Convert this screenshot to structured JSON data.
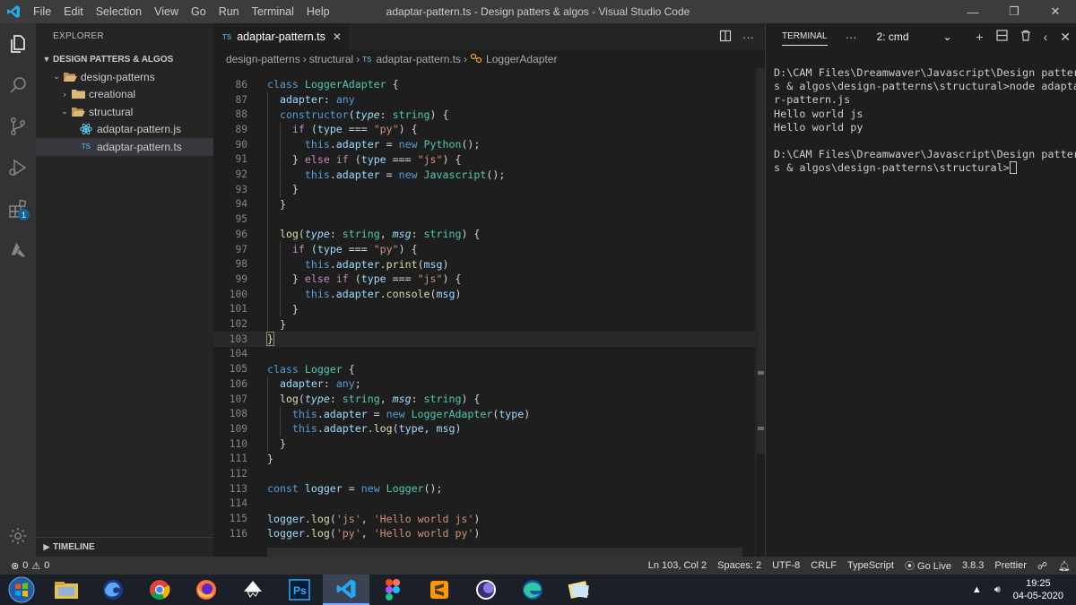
{
  "titlebar": {
    "menu": [
      "File",
      "Edit",
      "Selection",
      "View",
      "Go",
      "Run",
      "Terminal",
      "Help"
    ],
    "title": "adaptar-pattern.ts - Design patters & algos - Visual Studio Code"
  },
  "activitybar": {
    "extensions_badge": "1"
  },
  "sidebar": {
    "header": "EXPLORER",
    "workspace": "DESIGN PATTERS & ALGOS",
    "tree": [
      {
        "label": "design-patterns",
        "indent": 1,
        "expanded": true,
        "type": "folder"
      },
      {
        "label": "creational",
        "indent": 2,
        "expanded": false,
        "type": "folder"
      },
      {
        "label": "structural",
        "indent": 2,
        "expanded": true,
        "type": "folder"
      },
      {
        "label": "adaptar-pattern.js",
        "indent": 3,
        "type": "js"
      },
      {
        "label": "adaptar-pattern.ts",
        "indent": 3,
        "type": "ts",
        "selected": true
      }
    ],
    "timeline": "TIMELINE"
  },
  "editor": {
    "tab": {
      "icon": "TS",
      "label": "adaptar-pattern.ts"
    },
    "breadcrumb": [
      "design-patterns",
      "structural",
      "adaptar-pattern.ts",
      "LoggerAdapter"
    ],
    "current_line": 103,
    "lines": [
      {
        "n": 86,
        "t": [
          [
            "k2",
            "class "
          ],
          [
            "cl",
            "LoggerAdapter"
          ],
          [
            "dim",
            " "
          ],
          [
            "fn",
            "{"
          ]
        ]
      },
      {
        "n": 87,
        "t": [
          [
            "dim",
            "  "
          ],
          [
            "pr",
            "adapter"
          ],
          [
            "dim",
            ": "
          ],
          [
            "k2",
            "any"
          ]
        ]
      },
      {
        "n": 88,
        "t": [
          [
            "dim",
            "  "
          ],
          [
            "k2",
            "constructor"
          ],
          [
            "dim",
            "("
          ],
          [
            "prm",
            "type"
          ],
          [
            "dim",
            ": "
          ],
          [
            "ty",
            "string"
          ],
          [
            "dim",
            ") {"
          ]
        ]
      },
      {
        "n": 89,
        "t": [
          [
            "dim",
            "    "
          ],
          [
            "k",
            "if"
          ],
          [
            "dim",
            " ("
          ],
          [
            "pr",
            "type"
          ],
          [
            "dim",
            " === "
          ],
          [
            "st",
            "\"py\""
          ],
          [
            "dim",
            ") {"
          ]
        ]
      },
      {
        "n": 90,
        "t": [
          [
            "dim",
            "      "
          ],
          [
            "k2",
            "this"
          ],
          [
            "dim",
            "."
          ],
          [
            "pr",
            "adapter"
          ],
          [
            "dim",
            " = "
          ],
          [
            "k2",
            "new "
          ],
          [
            "cl",
            "Python"
          ],
          [
            "dim",
            "();"
          ]
        ]
      },
      {
        "n": 91,
        "t": [
          [
            "dim",
            "    } "
          ],
          [
            "k",
            "else if"
          ],
          [
            "dim",
            " ("
          ],
          [
            "pr",
            "type"
          ],
          [
            "dim",
            " === "
          ],
          [
            "st",
            "\"js\""
          ],
          [
            "dim",
            ") {"
          ]
        ]
      },
      {
        "n": 92,
        "t": [
          [
            "dim",
            "      "
          ],
          [
            "k2",
            "this"
          ],
          [
            "dim",
            "."
          ],
          [
            "pr",
            "adapter"
          ],
          [
            "dim",
            " = "
          ],
          [
            "k2",
            "new "
          ],
          [
            "cl",
            "Javascript"
          ],
          [
            "dim",
            "();"
          ]
        ]
      },
      {
        "n": 93,
        "t": [
          [
            "dim",
            "    }"
          ]
        ]
      },
      {
        "n": 94,
        "t": [
          [
            "dim",
            "  }"
          ]
        ]
      },
      {
        "n": 95,
        "t": []
      },
      {
        "n": 96,
        "t": [
          [
            "dim",
            "  "
          ],
          [
            "fn",
            "log"
          ],
          [
            "dim",
            "("
          ],
          [
            "prm",
            "type"
          ],
          [
            "dim",
            ": "
          ],
          [
            "ty",
            "string"
          ],
          [
            "dim",
            ", "
          ],
          [
            "prm",
            "msg"
          ],
          [
            "dim",
            ": "
          ],
          [
            "ty",
            "string"
          ],
          [
            "dim",
            ") {"
          ]
        ]
      },
      {
        "n": 97,
        "t": [
          [
            "dim",
            "    "
          ],
          [
            "k",
            "if"
          ],
          [
            "dim",
            " ("
          ],
          [
            "pr",
            "type"
          ],
          [
            "dim",
            " === "
          ],
          [
            "st",
            "\"py\""
          ],
          [
            "dim",
            ") {"
          ]
        ]
      },
      {
        "n": 98,
        "t": [
          [
            "dim",
            "      "
          ],
          [
            "k2",
            "this"
          ],
          [
            "dim",
            "."
          ],
          [
            "pr",
            "adapter"
          ],
          [
            "dim",
            "."
          ],
          [
            "fn",
            "print"
          ],
          [
            "dim",
            "("
          ],
          [
            "pr",
            "msg"
          ],
          [
            "dim",
            ")"
          ]
        ]
      },
      {
        "n": 99,
        "t": [
          [
            "dim",
            "    } "
          ],
          [
            "k",
            "else if"
          ],
          [
            "dim",
            " ("
          ],
          [
            "pr",
            "type"
          ],
          [
            "dim",
            " === "
          ],
          [
            "st",
            "\"js\""
          ],
          [
            "dim",
            ") {"
          ]
        ]
      },
      {
        "n": 100,
        "t": [
          [
            "dim",
            "      "
          ],
          [
            "k2",
            "this"
          ],
          [
            "dim",
            "."
          ],
          [
            "pr",
            "adapter"
          ],
          [
            "dim",
            "."
          ],
          [
            "fn",
            "console"
          ],
          [
            "dim",
            "("
          ],
          [
            "pr",
            "msg"
          ],
          [
            "dim",
            ")"
          ]
        ]
      },
      {
        "n": 101,
        "t": [
          [
            "dim",
            "    }"
          ]
        ]
      },
      {
        "n": 102,
        "t": [
          [
            "dim",
            "  }"
          ]
        ]
      },
      {
        "n": 103,
        "t": [
          [
            "fn",
            "}"
          ]
        ]
      },
      {
        "n": 104,
        "t": []
      },
      {
        "n": 105,
        "t": [
          [
            "k2",
            "class "
          ],
          [
            "cl",
            "Logger"
          ],
          [
            "dim",
            " {"
          ]
        ]
      },
      {
        "n": 106,
        "t": [
          [
            "dim",
            "  "
          ],
          [
            "pr",
            "adapter"
          ],
          [
            "dim",
            ": "
          ],
          [
            "k2",
            "any"
          ],
          [
            "dim",
            ";"
          ]
        ]
      },
      {
        "n": 107,
        "t": [
          [
            "dim",
            "  "
          ],
          [
            "fn",
            "log"
          ],
          [
            "dim",
            "("
          ],
          [
            "prm",
            "type"
          ],
          [
            "dim",
            ": "
          ],
          [
            "ty",
            "string"
          ],
          [
            "dim",
            ", "
          ],
          [
            "prm",
            "msg"
          ],
          [
            "dim",
            ": "
          ],
          [
            "ty",
            "string"
          ],
          [
            "dim",
            ") {"
          ]
        ]
      },
      {
        "n": 108,
        "t": [
          [
            "dim",
            "    "
          ],
          [
            "k2",
            "this"
          ],
          [
            "dim",
            "."
          ],
          [
            "pr",
            "adapter"
          ],
          [
            "dim",
            " = "
          ],
          [
            "k2",
            "new "
          ],
          [
            "cl",
            "LoggerAdapter"
          ],
          [
            "dim",
            "("
          ],
          [
            "pr",
            "type"
          ],
          [
            "dim",
            ")"
          ]
        ]
      },
      {
        "n": 109,
        "t": [
          [
            "dim",
            "    "
          ],
          [
            "k2",
            "this"
          ],
          [
            "dim",
            "."
          ],
          [
            "pr",
            "adapter"
          ],
          [
            "dim",
            "."
          ],
          [
            "fn",
            "log"
          ],
          [
            "dim",
            "("
          ],
          [
            "pr",
            "type"
          ],
          [
            "dim",
            ", "
          ],
          [
            "pr",
            "msg"
          ],
          [
            "dim",
            ")"
          ]
        ]
      },
      {
        "n": 110,
        "t": [
          [
            "dim",
            "  }"
          ]
        ]
      },
      {
        "n": 111,
        "t": [
          [
            "dim",
            "}"
          ]
        ]
      },
      {
        "n": 112,
        "t": []
      },
      {
        "n": 113,
        "t": [
          [
            "k2",
            "const "
          ],
          [
            "pr",
            "logger"
          ],
          [
            "dim",
            " = "
          ],
          [
            "k2",
            "new "
          ],
          [
            "cl",
            "Logger"
          ],
          [
            "dim",
            "();"
          ]
        ]
      },
      {
        "n": 114,
        "t": []
      },
      {
        "n": 115,
        "t": [
          [
            "pr",
            "logger"
          ],
          [
            "dim",
            "."
          ],
          [
            "fn",
            "log"
          ],
          [
            "dim",
            "("
          ],
          [
            "st",
            "'js'"
          ],
          [
            "dim",
            ", "
          ],
          [
            "st",
            "'Hello world js'"
          ],
          [
            "dim",
            ")"
          ]
        ]
      },
      {
        "n": 116,
        "t": [
          [
            "pr",
            "logger"
          ],
          [
            "dim",
            "."
          ],
          [
            "fn",
            "log"
          ],
          [
            "dim",
            "("
          ],
          [
            "st",
            "'py'"
          ],
          [
            "dim",
            ", "
          ],
          [
            "st",
            "'Hello world py'"
          ],
          [
            "dim",
            ")"
          ]
        ]
      }
    ]
  },
  "terminal": {
    "title": "TERMINAL",
    "shell": "2: cmd",
    "lines": [
      "D:\\CAM Files\\Dreamwaver\\Javascript\\Design patter",
      "s & algos\\design-patterns\\structural>node adapta",
      "r-pattern.js",
      "Hello world js",
      "Hello world py",
      "",
      "D:\\CAM Files\\Dreamwaver\\Javascript\\Design patter",
      "s & algos\\design-patterns\\structural>"
    ]
  },
  "statusbar": {
    "errors": "0",
    "warnings": "0",
    "position": "Ln 103, Col 2",
    "spaces": "Spaces: 2",
    "encoding": "UTF-8",
    "eol": "CRLF",
    "language": "TypeScript",
    "golive": "Go Live",
    "version": "3.8.3",
    "prettier": "Prettier"
  },
  "taskbar": {
    "time": "19:25",
    "date": "04-05-2020",
    "ps_label": "Ps"
  }
}
